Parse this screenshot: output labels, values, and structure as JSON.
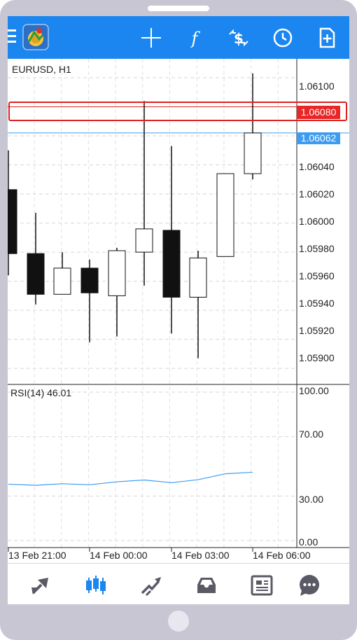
{
  "toolbar": {
    "icons": [
      "menu-icon",
      "metatrader-logo",
      "crosshair-icon",
      "indicators-icon",
      "trade-icon",
      "timeframe-clock-icon",
      "add-object-icon"
    ],
    "accent_color": "#1b86f0"
  },
  "chart": {
    "symbol_label": "EURUSD, H1",
    "price_ticks": [
      "1.06100",
      "1.06040",
      "1.06020",
      "1.06000",
      "1.05980",
      "1.05960",
      "1.05940",
      "1.05920",
      "1.05900"
    ],
    "highlighted_price": "1.06080",
    "bid_price": "1.06062",
    "time_ticks": [
      "13 Feb 21:00",
      "14 Feb 00:00",
      "14 Feb 03:00",
      "14 Feb 06:00"
    ],
    "highlight_color": "#e82626",
    "bid_color": "#3d9cf0"
  },
  "rsi": {
    "label": "RSI(14) 46.01",
    "levels": [
      "100.00",
      "70.00",
      "30.00",
      "0.00"
    ],
    "line_color": "#3d9cf0"
  },
  "chart_data": {
    "type": "candlestick",
    "candles": [
      {
        "open": 1.06023,
        "high": 1.0605,
        "low": 1.05964,
        "close": 1.05979
      },
      {
        "open": 1.05979,
        "high": 1.06007,
        "low": 1.05944,
        "close": 1.05951
      },
      {
        "open": 1.05951,
        "high": 1.0598,
        "low": 1.05955,
        "close": 1.05969
      },
      {
        "open": 1.05969,
        "high": 1.05975,
        "low": 1.05918,
        "close": 1.05952
      },
      {
        "open": 1.0595,
        "high": 1.05983,
        "low": 1.05922,
        "close": 1.05981
      },
      {
        "open": 1.0598,
        "high": 1.06084,
        "low": 1.05957,
        "close": 1.05996
      },
      {
        "open": 1.05995,
        "high": 1.06053,
        "low": 1.05924,
        "close": 1.05949
      },
      {
        "open": 1.05949,
        "high": 1.05981,
        "low": 1.05907,
        "close": 1.05976
      },
      {
        "open": 1.05977,
        "high": 1.06034,
        "low": 1.05977,
        "close": 1.06034
      },
      {
        "open": 1.06034,
        "high": 1.06103,
        "low": 1.0603,
        "close": 1.06062
      }
    ],
    "ylim": [
      1.05889,
      1.06113
    ],
    "rsi_values": [
      38.0,
      37.2,
      38.3,
      37.6,
      39.6,
      40.8,
      39.0,
      41.0,
      45.0,
      46.01
    ],
    "rsi_ylim": [
      0,
      100
    ]
  },
  "bottom_nav": {
    "icons": [
      "quotes-icon",
      "chart-icon",
      "trade-icon",
      "history-icon",
      "news-icon",
      "chat-icon"
    ],
    "active": "chart-icon",
    "active_color": "#1b86f0"
  }
}
